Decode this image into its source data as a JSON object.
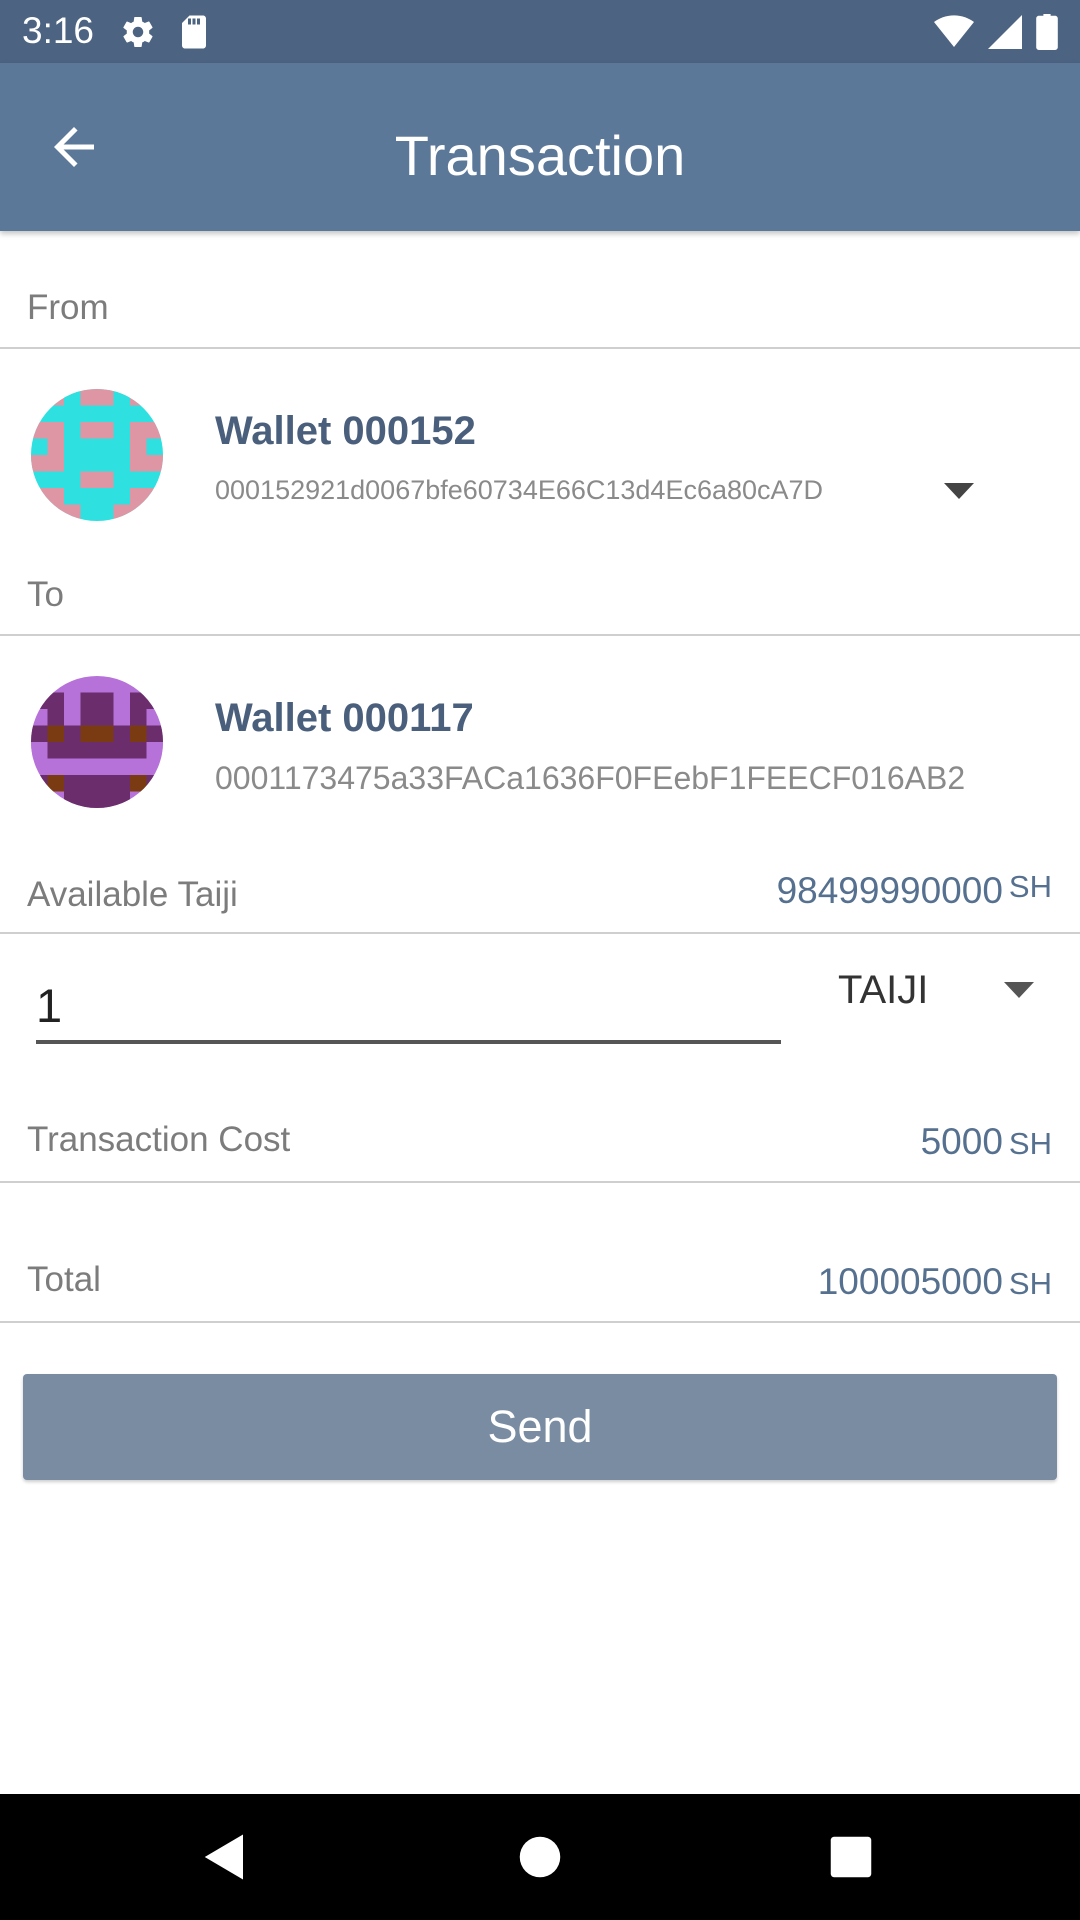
{
  "status_bar": {
    "time": "3:16",
    "icons": [
      "settings-gear-icon",
      "sd-card-icon",
      "wifi-icon",
      "cell-signal-icon",
      "battery-icon"
    ]
  },
  "app_bar": {
    "title": "Transaction",
    "back_icon": "arrow-back-icon"
  },
  "from_section": {
    "label": "From",
    "wallet": {
      "name": "Wallet 000152",
      "address": "000152921d0067bfe60734E66C13d4Ec6a80cA7D",
      "avatar_colors": [
        "#2ee0e0",
        "#de96a4"
      ]
    }
  },
  "to_section": {
    "label": "To",
    "wallet": {
      "name": "Wallet 000117",
      "address": "0001173475a33FACa1636F0FEebF1FEECF016AB2",
      "avatar_colors": [
        "#b672d8",
        "#6b2d6b",
        "#7a3b12"
      ]
    }
  },
  "available": {
    "label": "Available Taiji",
    "value": "98499990000",
    "unit": "SH"
  },
  "amount": {
    "value": "1",
    "currency": "TAIJI"
  },
  "transaction_cost": {
    "label": "Transaction Cost",
    "value": "5000",
    "unit": "SH"
  },
  "total": {
    "label": "Total",
    "value": "100005000",
    "unit": "SH"
  },
  "send_button": {
    "label": "Send"
  },
  "colors": {
    "status_bar": "#4c6381",
    "app_bar": "#5b7899",
    "accent_text": "#4a5f7c",
    "value_text": "#56708f",
    "send_button": "#7a8ca2"
  },
  "nav_bar": {
    "icons": [
      "nav-back-icon",
      "nav-home-icon",
      "nav-recents-icon"
    ]
  }
}
